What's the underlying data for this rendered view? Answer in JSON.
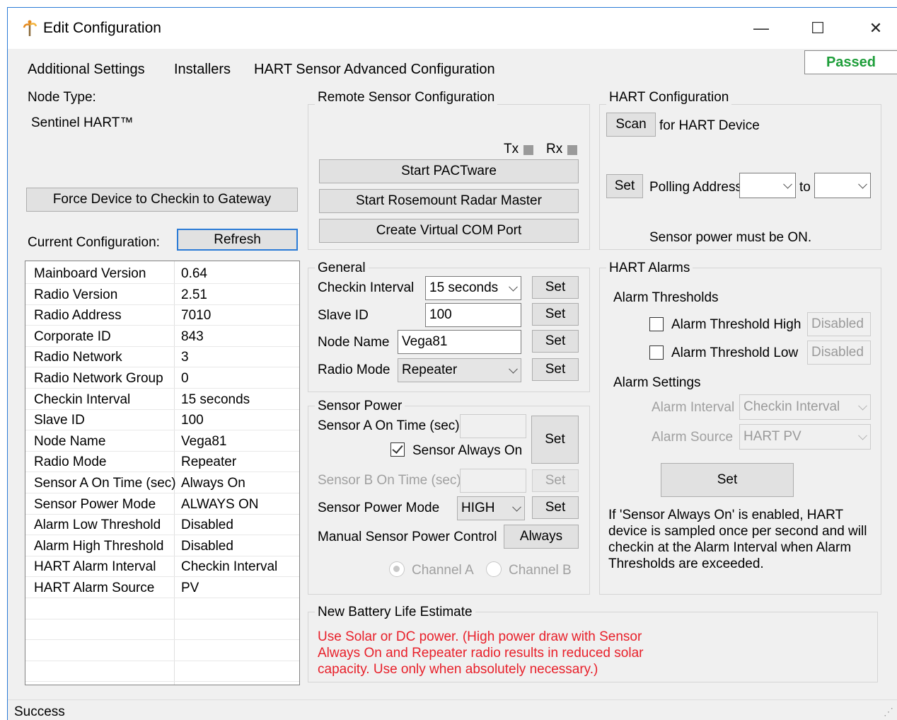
{
  "window": {
    "title": "Edit Configuration",
    "minimize": "—",
    "maximize": "☐",
    "close": "✕"
  },
  "menu": {
    "items": [
      "Additional Settings",
      "Installers",
      "HART Sensor Advanced Configuration"
    ],
    "status": "Passed"
  },
  "node": {
    "type_label": "Node Type:",
    "type_value": "Sentinel HART™",
    "force_button": "Force Device to Checkin to Gateway",
    "current_label": "Current Configuration:",
    "refresh_button": "Refresh"
  },
  "current_config": [
    [
      "Mainboard Version",
      "0.64"
    ],
    [
      "Radio Version",
      "2.51"
    ],
    [
      "Radio Address",
      "7010"
    ],
    [
      "Corporate ID",
      "843"
    ],
    [
      "Radio Network",
      "3"
    ],
    [
      "Radio Network Group",
      "0"
    ],
    [
      "Checkin Interval",
      "15 seconds"
    ],
    [
      "Slave ID",
      "100"
    ],
    [
      "Node Name",
      "Vega81"
    ],
    [
      "Radio Mode",
      "Repeater"
    ],
    [
      "Sensor A On Time (sec)",
      "Always On"
    ],
    [
      "Sensor Power Mode",
      "ALWAYS ON"
    ],
    [
      "Alarm Low Threshold",
      "Disabled"
    ],
    [
      "Alarm High Threshold",
      "Disabled"
    ],
    [
      "HART Alarm Interval",
      "Checkin Interval"
    ],
    [
      "HART Alarm Source",
      "PV"
    ]
  ],
  "remote": {
    "title": "Remote Sensor Configuration",
    "tx": "Tx",
    "rx": "Rx",
    "pactware": "Start PACTware",
    "radar": "Start Rosemount Radar Master",
    "com": "Create Virtual COM Port"
  },
  "general": {
    "title": "General",
    "checkin_label": "Checkin Interval",
    "checkin_value": "15 seconds",
    "slave_label": "Slave ID",
    "slave_value": "100",
    "node_label": "Node Name",
    "node_value": "Vega81",
    "radio_label": "Radio Mode",
    "radio_value": "Repeater",
    "set": "Set"
  },
  "sensor_power": {
    "title": "Sensor Power",
    "a_label": "Sensor A On Time (sec)",
    "always_on": "Sensor Always On",
    "b_label": "Sensor B On Time (sec)",
    "mode_label": "Sensor Power Mode",
    "mode_value": "HIGH",
    "manual_label": "Manual Sensor Power Control",
    "manual_button": "Always",
    "channel_a": "Channel A",
    "channel_b": "Channel B",
    "set": "Set"
  },
  "battery": {
    "title": "New Battery Life Estimate",
    "line1": "Use Solar or DC power. (High power draw with Sensor",
    "line2": "Always On and Repeater radio results in reduced solar",
    "line3": "capacity. Use only when absolutely necessary.)"
  },
  "hart_config": {
    "title": "HART Configuration",
    "scan": "Scan",
    "scan_label": "for HART Device",
    "set": "Set",
    "polling_label": "Polling Address",
    "to": "to",
    "note": "Sensor power must be ON."
  },
  "hart_alarms": {
    "title": "HART Alarms",
    "thresholds": "Alarm Thresholds",
    "high_label": "Alarm Threshold High",
    "high_value": "Disabled",
    "low_label": "Alarm Threshold Low",
    "low_value": "Disabled",
    "settings": "Alarm Settings",
    "interval_label": "Alarm Interval",
    "interval_value": "Checkin Interval",
    "source_label": "Alarm Source",
    "source_value": "HART PV",
    "set": "Set",
    "info1": "If 'Sensor Always On' is enabled, HART",
    "info2": "device is sampled once per second and will",
    "info3": "checkin at the Alarm Interval when Alarm",
    "info4": "Thresholds are exceeded."
  },
  "status": {
    "text": "Success"
  }
}
